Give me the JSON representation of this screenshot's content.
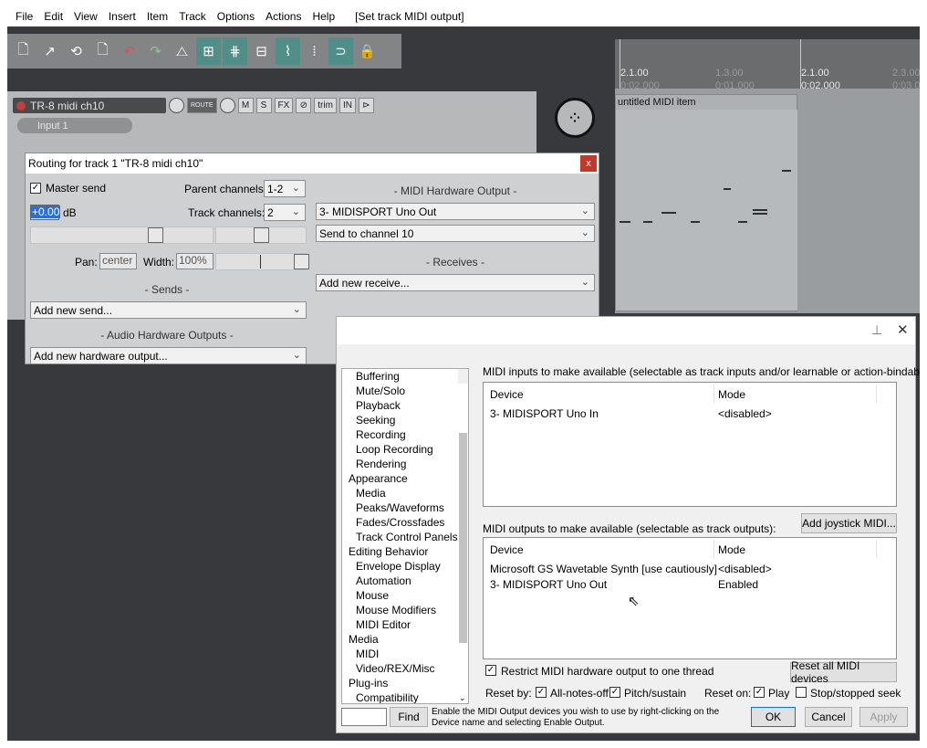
{
  "menu": {
    "items": [
      "File",
      "Edit",
      "View",
      "Insert",
      "Item",
      "Track",
      "Options",
      "Actions",
      "Help"
    ],
    "window_title": "[Set track MIDI output]"
  },
  "ruler": {
    "pos1": "2.1.00",
    "time1": "0:02.000",
    "pos2": "1.3.00",
    "time2": "0:01.000",
    "pos3": "2.1.00",
    "time3": "0:02.000",
    "pos4": "2.3.00",
    "time4": "0:03.0"
  },
  "midi_item": {
    "name": "untitled MIDI item"
  },
  "track": {
    "name": "TR-8 midi ch10",
    "route_label": "ROUTE",
    "mute": "M",
    "solo": "S",
    "fx": "FX",
    "trim": "trim",
    "in": "IN",
    "input": "Input 1"
  },
  "routing": {
    "title": "Routing for track 1 \"TR-8 midi ch10\"",
    "close": "x",
    "master_send": "Master send",
    "master_checked": "✓",
    "parent_channels_label": "Parent channels:",
    "parent_channels_value": "1-2",
    "volume_value": "+0.00",
    "db": "dB",
    "track_channels_label": "Track channels:",
    "track_channels_value": "2",
    "pan_label": "Pan:",
    "pan_value": "center",
    "width_label": "Width:",
    "width_value": "100%",
    "sends_label": "- Sends -",
    "add_send": "Add new send...",
    "audio_hw_label": "- Audio Hardware Outputs -",
    "add_hw": "Add new hardware output...",
    "midi_hw_label": "- MIDI Hardware Output -",
    "midi_device": "3- MIDISPORT Uno Out",
    "midi_channel": "Send to channel 10",
    "receives_label": "- Receives -",
    "add_receive": "Add new receive..."
  },
  "prefs": {
    "tree": [
      {
        "label": "Buffering",
        "level": 1
      },
      {
        "label": "Mute/Solo",
        "level": 1
      },
      {
        "label": "Playback",
        "level": 1
      },
      {
        "label": "Seeking",
        "level": 1
      },
      {
        "label": "Recording",
        "level": 1
      },
      {
        "label": "Loop Recording",
        "level": 1
      },
      {
        "label": "Rendering",
        "level": 1
      },
      {
        "label": "Appearance",
        "level": 0
      },
      {
        "label": "Media",
        "level": 1
      },
      {
        "label": "Peaks/Waveforms",
        "level": 1
      },
      {
        "label": "Fades/Crossfades",
        "level": 1
      },
      {
        "label": "Track Control Panels",
        "level": 1
      },
      {
        "label": "Editing Behavior",
        "level": 0
      },
      {
        "label": "Envelope Display",
        "level": 1
      },
      {
        "label": "Automation",
        "level": 1
      },
      {
        "label": "Mouse",
        "level": 1
      },
      {
        "label": "Mouse Modifiers",
        "level": 1
      },
      {
        "label": "MIDI Editor",
        "level": 1
      },
      {
        "label": "Media",
        "level": 0
      },
      {
        "label": "MIDI",
        "level": 1
      },
      {
        "label": "Video/REX/Misc",
        "level": 1
      },
      {
        "label": "Plug-ins",
        "level": 0
      },
      {
        "label": "Compatibility",
        "level": 1
      }
    ],
    "inputs_caption": "MIDI inputs to make available (selectable as track inputs and/or learnable or action-bindable):",
    "col_device": "Device",
    "col_mode": "Mode",
    "inputs": [
      {
        "device": "3- MIDISPORT Uno In",
        "mode": "<disabled>"
      }
    ],
    "add_joystick": "Add joystick MIDI...",
    "outputs_caption": "MIDI outputs to make available (selectable as track outputs):",
    "outputs": [
      {
        "device": "Microsoft GS Wavetable Synth [use cautiously]",
        "mode": "<disabled>"
      },
      {
        "device": "3- MIDISPORT Uno Out",
        "mode": "Enabled"
      }
    ],
    "restrict_label": "Restrict MIDI hardware output to one thread",
    "reset_all": "Reset all MIDI devices",
    "reset_by": "Reset by:",
    "all_notes_off": "All-notes-off",
    "pitch_sustain": "Pitch/sustain",
    "reset_on": "Reset on:",
    "play": "Play",
    "stop_seek": "Stop/stopped seek",
    "check": "✓",
    "find": "Find",
    "hint": "Enable the MIDI Output devices you wish to use by right-clicking on the Device name and selecting Enable Output.",
    "ok": "OK",
    "cancel": "Cancel",
    "apply": "Apply",
    "close": "✕",
    "pin": "⊥"
  }
}
